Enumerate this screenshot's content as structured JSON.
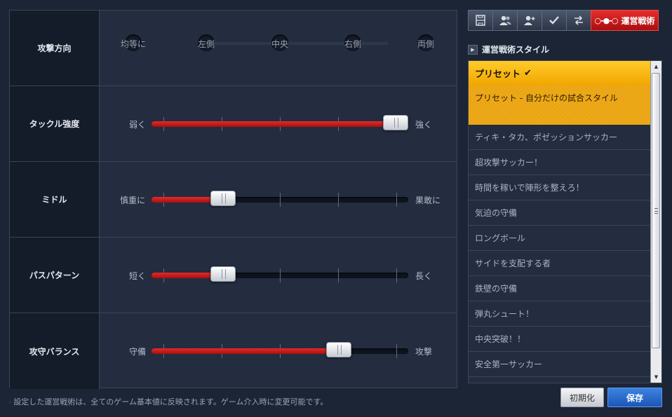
{
  "sliders": [
    {
      "label": "攻撃方向",
      "type": "options",
      "options": [
        "均等に",
        "左側",
        "中央",
        "右側",
        "両側"
      ]
    },
    {
      "label": "タックル強度",
      "type": "slider",
      "min_label": "弱く",
      "max_label": "強く",
      "value": 0.95
    },
    {
      "label": "ミドル",
      "type": "slider",
      "min_label": "慎重に",
      "max_label": "果敢に",
      "value": 0.28
    },
    {
      "label": "パスパターン",
      "type": "slider",
      "min_label": "短く",
      "max_label": "長く",
      "value": 0.28
    },
    {
      "label": "攻守バランス",
      "type": "slider",
      "min_label": "守備",
      "max_label": "攻撃",
      "value": 0.73
    }
  ],
  "footnote": "設定した運営戦術は、全てのゲーム基本値に反映されます。ゲーム介入時に変更可能です。",
  "toolbar": {
    "active_label": "運営戦術",
    "icons": [
      "formation-icon",
      "players-icon",
      "add-player-icon",
      "check-icon",
      "swap-icon",
      "tactics-icon"
    ]
  },
  "style_panel": {
    "title": "運営戦術スタイル",
    "selected_title": "プリセット",
    "selected_desc": "プリセット - 自分だけの試合スタイル",
    "items": [
      "ティキ・タカ、ポゼッションサッカー",
      "超攻撃サッカー！",
      "時間を稼いで陣形を整えろ！",
      "気迫の守備",
      "ロングボール",
      "サイドを支配する者",
      "鉄壁の守備",
      "弾丸シュート！",
      "中央突破！！",
      "安全第一サッカー"
    ]
  },
  "buttons": {
    "reset": "初期化",
    "save": "保存"
  },
  "colors": {
    "accent_red": "#d21a1a",
    "selected_gold": "#f5b800",
    "save_blue": "#2a6ad0"
  }
}
